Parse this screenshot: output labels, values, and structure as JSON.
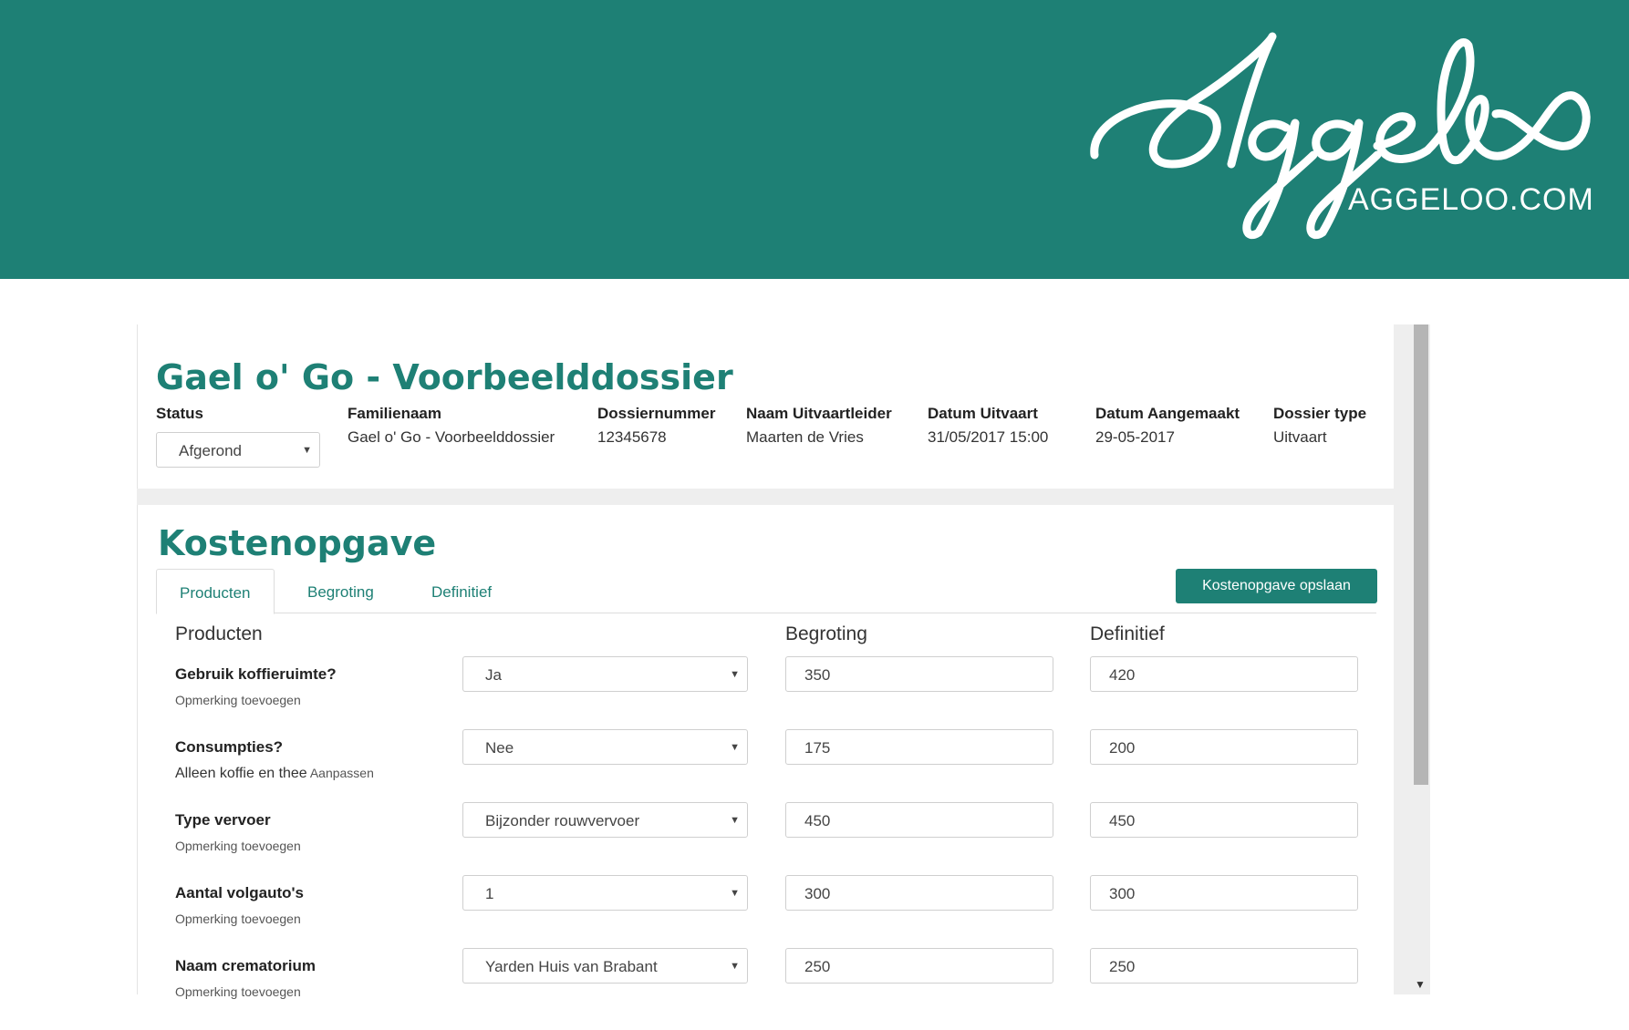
{
  "brand": {
    "logo_script": "Aggeloo",
    "logo_sub": "AGGELOO.COM"
  },
  "dossier": {
    "title": "Gael o' Go - Voorbeelddossier",
    "status_label": "Status",
    "status_value": "Afgerond",
    "fields": [
      {
        "label": "Familienaam",
        "value": "Gael o' Go - Voorbeelddossier"
      },
      {
        "label": "Dossiernummer",
        "value": "12345678"
      },
      {
        "label": "Naam Uitvaartleider",
        "value": "Maarten de Vries"
      },
      {
        "label": "Datum Uitvaart",
        "value": "31/05/2017 15:00"
      },
      {
        "label": "Datum Aangemaakt",
        "value": "29-05-2017"
      },
      {
        "label": "Dossier type",
        "value": "Uitvaart"
      }
    ]
  },
  "kosten": {
    "title": "Kostenopgave",
    "tabs": [
      "Producten",
      "Begroting",
      "Definitief"
    ],
    "save_label": "Kostenopgave opslaan",
    "col_products": "Producten",
    "col_begroting": "Begroting",
    "col_definitief": "Definitief",
    "rows": [
      {
        "name": "Gebruik koffieruimte?",
        "sub_text": "",
        "sub_link": "Opmerking toevoegen",
        "option": "Ja",
        "begroting": "350",
        "definitief": "420"
      },
      {
        "name": "Consumpties?",
        "sub_text": "Alleen koffie en thee",
        "sub_link": "Aanpassen",
        "option": "Nee",
        "begroting": "175",
        "definitief": "200"
      },
      {
        "name": "Type vervoer",
        "sub_text": "",
        "sub_link": "Opmerking toevoegen",
        "option": "Bijzonder rouwvervoer",
        "begroting": "450",
        "definitief": "450"
      },
      {
        "name": "Aantal volgauto's",
        "sub_text": "",
        "sub_link": "Opmerking toevoegen",
        "option": "1",
        "begroting": "300",
        "definitief": "300"
      },
      {
        "name": "Naam crematorium",
        "sub_text": "",
        "sub_link": "Opmerking toevoegen",
        "option": "Yarden Huis van Brabant",
        "begroting": "250",
        "definitief": "250"
      }
    ]
  },
  "colors": {
    "brand": "#1e8075",
    "panel_bg": "#eeeeee"
  }
}
